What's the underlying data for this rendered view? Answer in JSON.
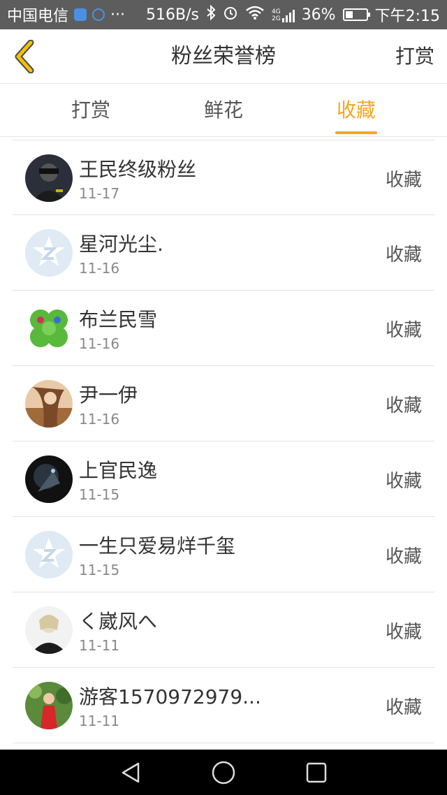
{
  "status_bar": {
    "carrier": "中国电信",
    "more": "···",
    "speed": "516B/s",
    "network": "4G",
    "network2": "2G",
    "battery": "36%",
    "time": "下午2:15"
  },
  "header": {
    "title": "粉丝荣誉榜",
    "action_label": "打赏"
  },
  "tabs": [
    {
      "label": "打赏",
      "active": false
    },
    {
      "label": "鲜花",
      "active": false
    },
    {
      "label": "收藏",
      "active": true
    }
  ],
  "colors": {
    "accent": "#f5a623",
    "status_bar": "#5d5d5d"
  },
  "fans": [
    {
      "name": "王民终级粉丝",
      "date": "11-17",
      "action": "收藏",
      "avatar": "dark-figure-avatar"
    },
    {
      "name": "星河光尘.",
      "date": "11-16",
      "action": "收藏",
      "avatar": "default-star-avatar"
    },
    {
      "name": "布兰民雪",
      "date": "11-16",
      "action": "收藏",
      "avatar": "clover-avatar"
    },
    {
      "name": "尹一伊",
      "date": "11-16",
      "action": "收藏",
      "avatar": "girl-photo-avatar"
    },
    {
      "name": "上官民逸",
      "date": "11-15",
      "action": "收藏",
      "avatar": "game-character-avatar"
    },
    {
      "name": "一生只爱易烊千玺",
      "date": "11-15",
      "action": "收藏",
      "avatar": "default-star-avatar"
    },
    {
      "name": "く崴风へ",
      "date": "11-11",
      "action": "收藏",
      "avatar": "person-photo-avatar"
    },
    {
      "name": "游客1570972979...",
      "date": "11-11",
      "action": "收藏",
      "avatar": "red-dress-photo-avatar"
    }
  ]
}
